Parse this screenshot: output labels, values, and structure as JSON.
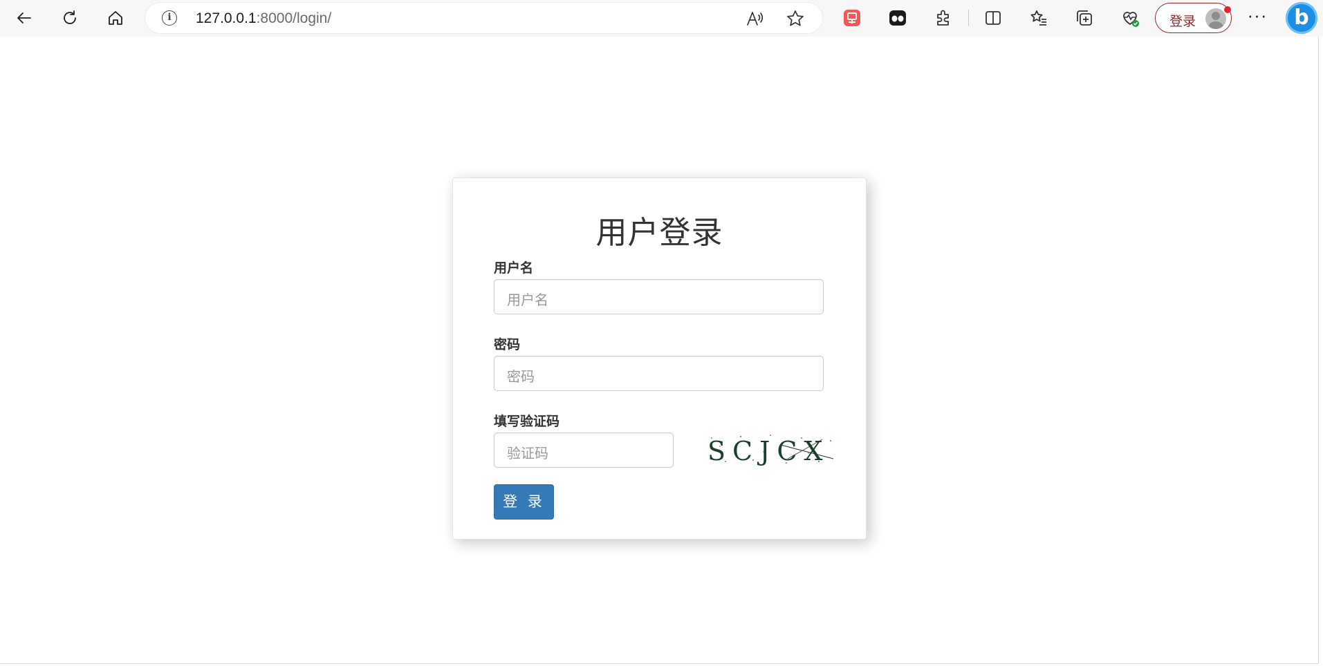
{
  "browser": {
    "url_host": "127.0.0.1",
    "url_path": ":8000/login/",
    "profile_button_label": "登录",
    "icons": {
      "back": "back-arrow-icon",
      "refresh": "refresh-icon",
      "home": "home-icon",
      "site_info": "info-icon",
      "read_aloud": "read-aloud-icon",
      "favorite": "star-icon",
      "ext1": "red-extension-icon",
      "ext2": "dark-extension-icon",
      "extensions": "puzzle-icon",
      "split": "split-screen-icon",
      "favorites": "favorites-icon",
      "collections": "collections-icon",
      "health": "browser-essentials-icon",
      "more": "more-icon",
      "copilot": "bing-icon"
    }
  },
  "page": {
    "title": "用户登录",
    "username_label": "用户名",
    "username_placeholder": "用户名",
    "password_label": "密码",
    "password_placeholder": "密码",
    "captcha_label": "填写验证码",
    "captcha_placeholder": "验证码",
    "captcha_text": "SCJCX",
    "submit_label": "登 录"
  },
  "colors": {
    "primary_button": "#337ab7",
    "profile_accent": "#a32121",
    "notification_dot": "#e0262b"
  }
}
